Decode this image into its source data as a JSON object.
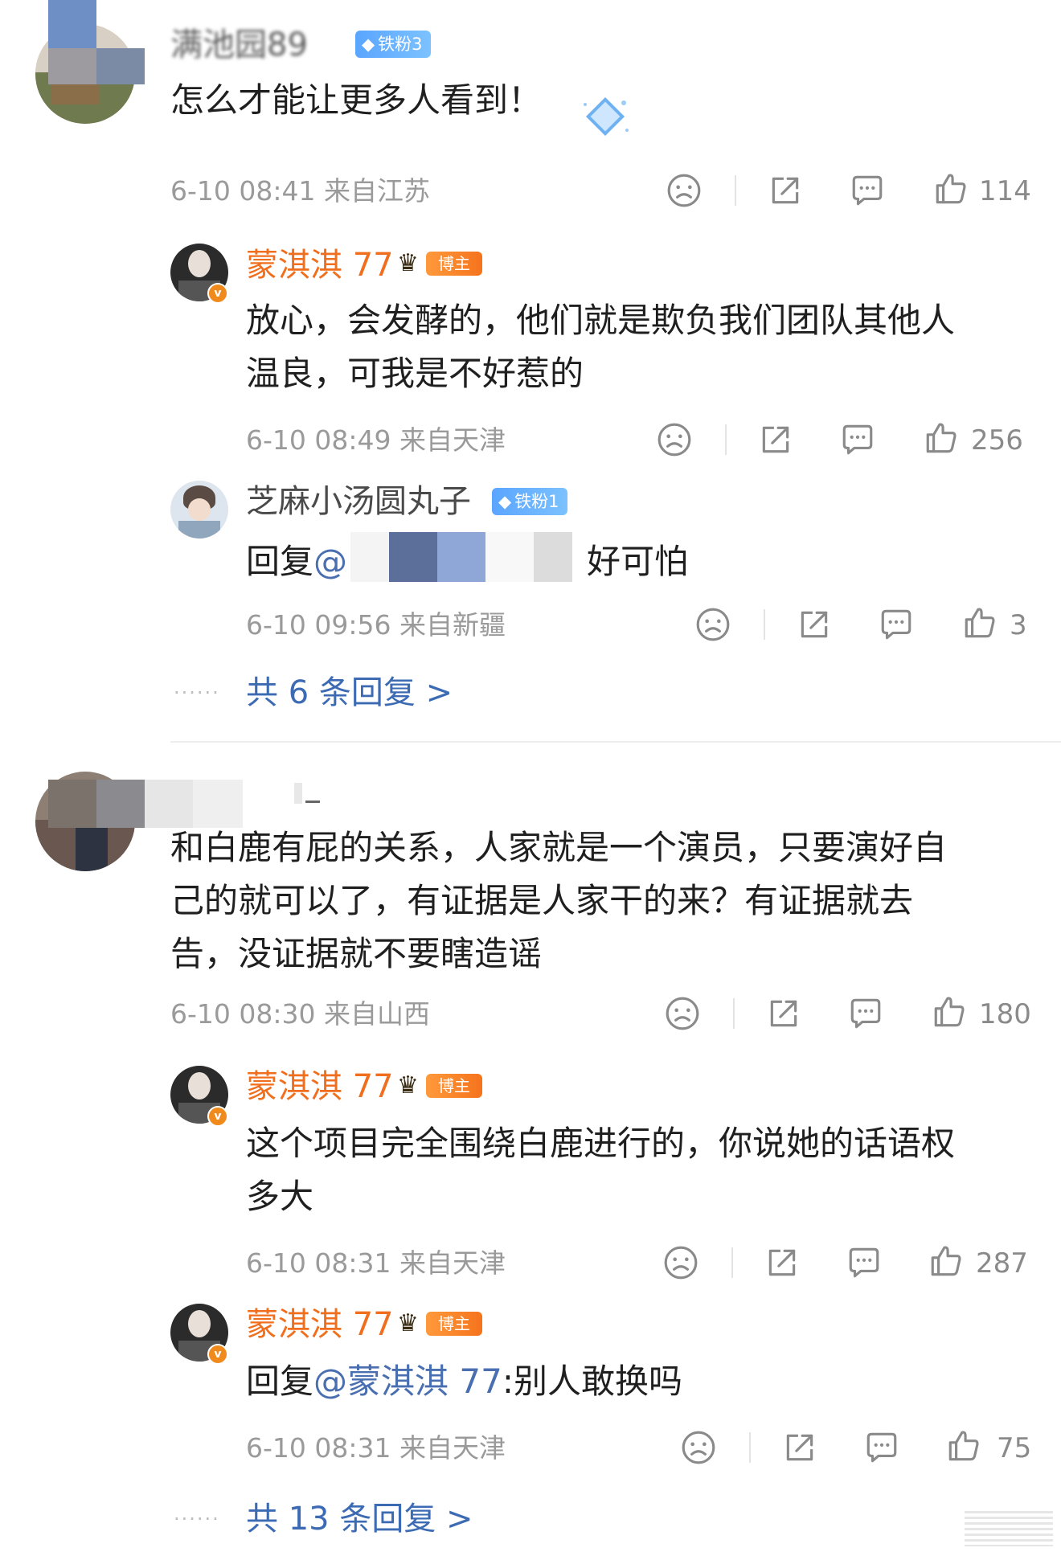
{
  "comments": [
    {
      "name": "满池园89",
      "badge": "铁粉3",
      "text": "怎么才能让更多人看到！",
      "time": "6-10 08:41 来自江苏",
      "likes": "114",
      "replies": [
        {
          "name": "蒙淇淇 77",
          "badge": "博主",
          "text_lines": [
            "放心，会发酵的，他们就是欺负我们团队其他人",
            "温良，可我是不好惹的"
          ],
          "time": "6-10 08:49 来自天津",
          "likes": "256"
        },
        {
          "name": "芝麻小汤圆丸子",
          "badge": "铁粉1",
          "reply_prefix": "回复",
          "at": "@",
          "text_tail": "好可怕",
          "time": "6-10 09:56 来自新疆",
          "likes": "3"
        }
      ],
      "more_label": "共 6 条回复 >"
    },
    {
      "text_lines": [
        "和白鹿有屁的关系，人家就是一个演员，只要演好自",
        "己的就可以了，有证据是人家干的来？有证据就去",
        "告，没证据就不要瞎造谣"
      ],
      "time": "6-10 08:30 来自山西",
      "likes": "180",
      "replies": [
        {
          "name": "蒙淇淇 77",
          "badge": "博主",
          "text_lines": [
            "这个项目完全围绕白鹿进行的，你说她的话语权",
            "多大"
          ],
          "time": "6-10 08:31 来自天津",
          "likes": "287"
        },
        {
          "name": "蒙淇淇 77",
          "badge": "博主",
          "reply_prefix": "回复",
          "mention": "@蒙淇淇 77",
          "text_tail": ":别人敢换吗",
          "time": "6-10 08:31 来自天津",
          "likes": "75"
        }
      ],
      "more_label": "共 13 条回复 >"
    }
  ],
  "icons": {
    "dislike": "frown-face-icon",
    "share": "share-icon",
    "comment": "comment-bubble-icon",
    "like": "thumbs-up-icon"
  },
  "colors": {
    "owner_name": "#f06f1e",
    "link": "#3c6bb4",
    "meta": "#9a9a9a",
    "fan_badge": "#5aa5ff",
    "owner_badge": "#f5731c"
  }
}
